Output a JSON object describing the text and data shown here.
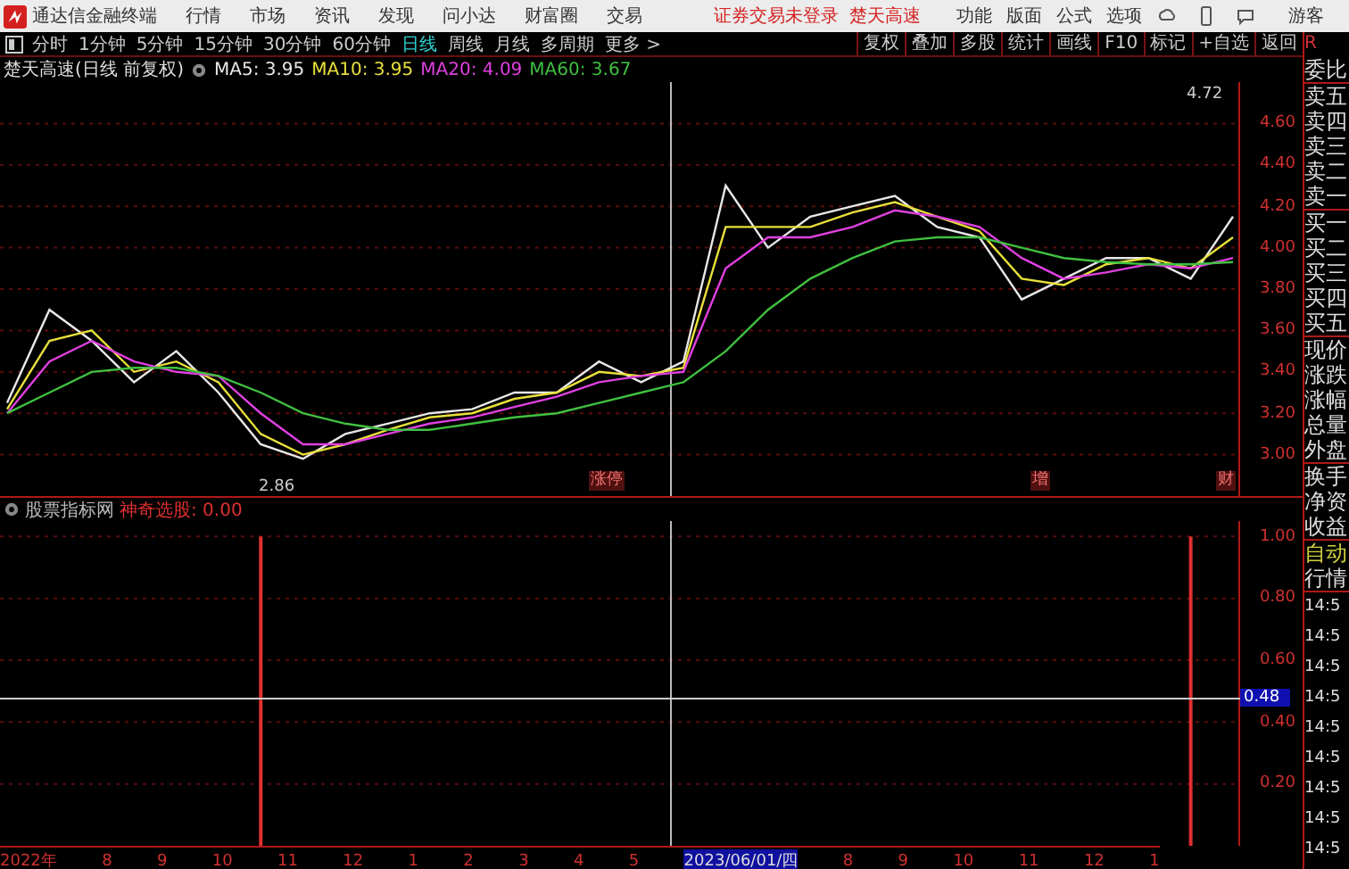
{
  "app": {
    "title": "通达信金融终端",
    "menu": [
      "行情",
      "市场",
      "资讯",
      "发现",
      "问小达",
      "财富圈",
      "交易"
    ],
    "notices": [
      "证券交易未登录",
      "楚天高速"
    ],
    "tools": [
      "功能",
      "版面",
      "公式",
      "选项"
    ],
    "user": "游客"
  },
  "period_tabs": [
    {
      "label": "分时",
      "selected": false
    },
    {
      "label": "1分钟",
      "selected": false
    },
    {
      "label": "5分钟",
      "selected": false
    },
    {
      "label": "15分钟",
      "selected": false
    },
    {
      "label": "30分钟",
      "selected": false
    },
    {
      "label": "60分钟",
      "selected": false
    },
    {
      "label": "日线",
      "selected": true
    },
    {
      "label": "周线",
      "selected": false
    },
    {
      "label": "月线",
      "selected": false
    },
    {
      "label": "多周期",
      "selected": false
    },
    {
      "label": "更多 >",
      "selected": false
    }
  ],
  "chart_buttons": [
    "复权",
    "叠加",
    "多股",
    "统计",
    "画线",
    "F10",
    "标记",
    "+自选",
    "返回"
  ],
  "price_panel": {
    "title": "楚天高速(日线 前复权)",
    "legend_values": [
      "3.95",
      "3.95",
      "4.09",
      "3.67"
    ],
    "high_label": "4.72",
    "low_label": "2.86",
    "events": [
      "涨停",
      "增",
      "财"
    ],
    "chart_data": {
      "type": "line",
      "grid": true,
      "ylim": [
        2.8,
        4.8
      ],
      "yticks": [
        {
          "value": 3.0,
          "label": "3.00"
        },
        {
          "value": 3.2,
          "label": "3.20"
        },
        {
          "value": 3.4,
          "label": "3.40"
        },
        {
          "value": 3.6,
          "label": "3.60"
        },
        {
          "value": 3.8,
          "label": "3.80"
        },
        {
          "value": 4.0,
          "label": "4.00"
        },
        {
          "value": 4.2,
          "label": "4.20"
        },
        {
          "value": 4.4,
          "label": "4.40"
        },
        {
          "value": 4.6,
          "label": "4.60"
        }
      ],
      "series": [
        {
          "name": "MA5:",
          "color": "#e8e8e8",
          "values": [
            3.25,
            3.7,
            3.55,
            3.35,
            3.5,
            3.3,
            3.05,
            2.98,
            3.1,
            3.15,
            3.2,
            3.22,
            3.3,
            3.3,
            3.45,
            3.35,
            3.45,
            4.3,
            4.0,
            4.15,
            4.2,
            4.25,
            4.1,
            4.05,
            3.75,
            3.85,
            3.95,
            3.95,
            3.85,
            4.15
          ]
        },
        {
          "name": "MA10:",
          "color": "#e8e03a",
          "values": [
            3.22,
            3.55,
            3.6,
            3.4,
            3.45,
            3.35,
            3.1,
            3.0,
            3.05,
            3.12,
            3.18,
            3.2,
            3.27,
            3.3,
            3.4,
            3.38,
            3.42,
            4.1,
            4.1,
            4.1,
            4.17,
            4.22,
            4.15,
            4.08,
            3.85,
            3.82,
            3.92,
            3.95,
            3.9,
            4.05
          ]
        },
        {
          "name": "MA20:",
          "color": "#e040e0",
          "values": [
            3.2,
            3.45,
            3.55,
            3.45,
            3.4,
            3.38,
            3.2,
            3.05,
            3.05,
            3.1,
            3.15,
            3.18,
            3.23,
            3.28,
            3.35,
            3.38,
            3.4,
            3.9,
            4.05,
            4.05,
            4.1,
            4.18,
            4.15,
            4.1,
            3.95,
            3.85,
            3.88,
            3.92,
            3.9,
            3.95
          ]
        },
        {
          "name": "MA60:",
          "color": "#40c040",
          "values": [
            3.2,
            3.3,
            3.4,
            3.42,
            3.42,
            3.38,
            3.3,
            3.2,
            3.15,
            3.12,
            3.12,
            3.15,
            3.18,
            3.2,
            3.25,
            3.3,
            3.35,
            3.5,
            3.7,
            3.85,
            3.95,
            4.03,
            4.05,
            4.05,
            4.0,
            3.95,
            3.93,
            3.92,
            3.92,
            3.93
          ]
        }
      ]
    }
  },
  "indicator_panel": {
    "name": "股票指标网",
    "reading": "0.00",
    "cursor_value": "0.48",
    "chart_data": {
      "type": "bar",
      "grid": true,
      "ylim": [
        0,
        1.05
      ],
      "yticks": [
        {
          "value": 0.2,
          "label": "0.20"
        },
        {
          "value": 0.4,
          "label": "0.40"
        },
        {
          "value": 0.6,
          "label": "0.60"
        },
        {
          "value": 0.8,
          "label": "0.80"
        },
        {
          "value": 1.0,
          "label": "1.00"
        }
      ],
      "series": [
        {
          "name": "神奇选股:",
          "color": "#e03030",
          "values": [
            0,
            0,
            0,
            0,
            0,
            0,
            1,
            0,
            0,
            0,
            0,
            0,
            0,
            0,
            0,
            0,
            0,
            0,
            0,
            0,
            0,
            0,
            0,
            0,
            0,
            0,
            0,
            0,
            1,
            0
          ]
        }
      ]
    }
  },
  "time_axis": [
    {
      "label": "2022年",
      "selected": false
    },
    {
      "label": "8",
      "selected": false
    },
    {
      "label": "9",
      "selected": false
    },
    {
      "label": "10",
      "selected": false
    },
    {
      "label": "11",
      "selected": false
    },
    {
      "label": "12",
      "selected": false
    },
    {
      "label": "1",
      "selected": false
    },
    {
      "label": "2",
      "selected": false
    },
    {
      "label": "3",
      "selected": false
    },
    {
      "label": "4",
      "selected": false
    },
    {
      "label": "5",
      "selected": false
    },
    {
      "label": "2023/06/01/四",
      "selected": true
    },
    {
      "label": "8",
      "selected": false
    },
    {
      "label": "9",
      "selected": false
    },
    {
      "label": "10",
      "selected": false
    },
    {
      "label": "11",
      "selected": false
    },
    {
      "label": "12",
      "selected": false
    },
    {
      "label": "1",
      "selected": false
    }
  ],
  "quote_panel": {
    "corner": "R",
    "groups": [
      [
        "委比"
      ],
      [
        "卖五",
        "卖四",
        "卖三",
        "卖二",
        "卖一"
      ],
      [
        "买一",
        "买二",
        "买三",
        "买四",
        "买五"
      ],
      [
        "现价",
        "涨跌",
        "涨幅",
        "总量",
        "外盘"
      ],
      [
        "换手",
        "净资",
        "收益"
      ]
    ],
    "mode": [
      "自动",
      "行情"
    ],
    "times": [
      "14:5",
      "14:5",
      "14:5",
      "14:5",
      "14:5",
      "14:5",
      "14:5",
      "14:5",
      "14:5"
    ]
  }
}
